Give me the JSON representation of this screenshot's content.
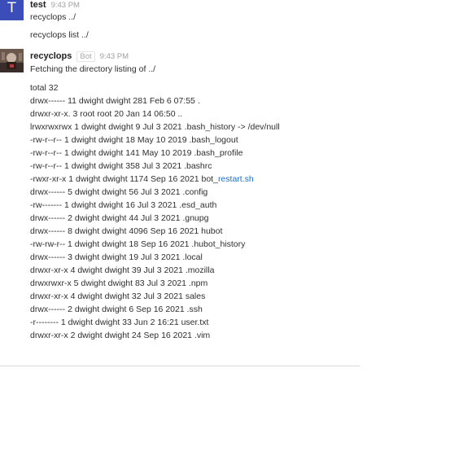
{
  "messages": [
    {
      "author": "test",
      "avatar_letter": "T",
      "time": "9:43 PM",
      "lines": [
        "recyclops ../",
        "recyclops list ../"
      ]
    },
    {
      "author": "recyclops",
      "badge": "Bot",
      "time": "9:43 PM",
      "intro": "Fetching the directory listing of ../",
      "listing": [
        "total 32",
        "drwx------ 11 dwight dwight 281 Feb 6 07:55 .",
        "drwxr-xr-x. 3 root root 20 Jan 14 06:50 ..",
        "lrwxrwxrwx 1 dwight dwight 9 Jul 3 2021 .bash_history -> /dev/null",
        "-rw-r--r-- 1 dwight dwight 18 May 10 2019 .bash_logout",
        "-rw-r--r-- 1 dwight dwight 141 May 10 2019 .bash_profile",
        "-rw-r--r-- 1 dwight dwight 358 Jul 3 2021 .bashrc",
        "-rwxr-xr-x 1 dwight dwight 1174 Sep 16 2021 bot_",
        "drwx------ 5 dwight dwight 56 Jul 3 2021 .config",
        "-rw------- 1 dwight dwight 16 Jul 3 2021 .esd_auth",
        "drwx------ 2 dwight dwight 44 Jul 3 2021 .gnupg",
        "drwx------ 8 dwight dwight 4096 Sep 16 2021 hubot",
        "-rw-rw-r-- 1 dwight dwight 18 Sep 16 2021 .hubot_history",
        "drwx------ 3 dwight dwight 19 Jul 3 2021 .local",
        "drwxr-xr-x 4 dwight dwight 39 Jul 3 2021 .mozilla",
        "drwxrwxr-x 5 dwight dwight 83 Jul 3 2021 .npm",
        "drwxr-xr-x 4 dwight dwight 32 Jul 3 2021 sales",
        "drwx------ 2 dwight dwight 6 Sep 16 2021 .ssh",
        "-r-------- 1 dwight dwight 33 Jun 2 16:21 user.txt",
        "drwxr-xr-x 2 dwight dwight 24 Sep 16 2021 .vim"
      ],
      "link_text": "restart.sh"
    }
  ]
}
